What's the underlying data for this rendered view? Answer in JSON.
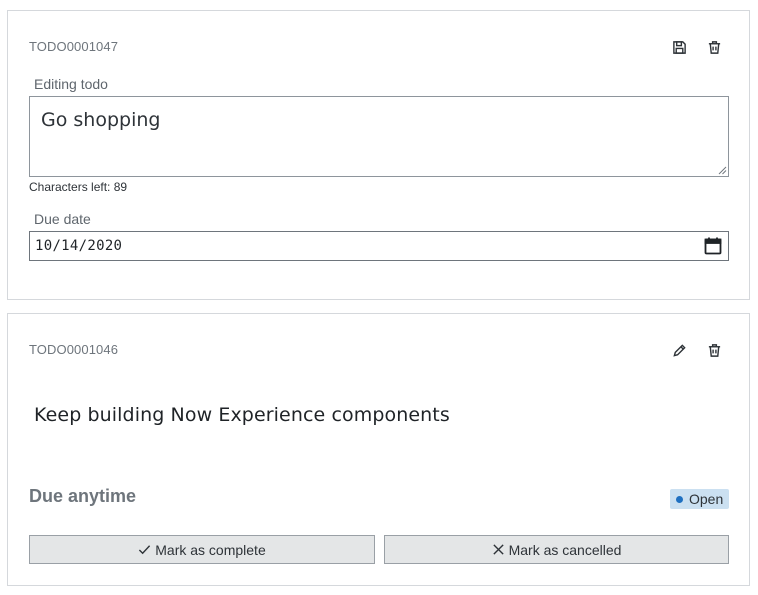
{
  "editing_card": {
    "todo_id": "TODO0001047",
    "save_icon": "save-icon",
    "delete_icon": "trash-icon",
    "text_label": "Editing todo",
    "text_value": "Go shopping",
    "chars_left": "Characters left: 89",
    "date_label": "Due date",
    "date_value": "10/14/2020",
    "calendar_icon": "calendar-icon"
  },
  "view_card": {
    "todo_id": "TODO0001046",
    "edit_icon": "pencil-icon",
    "delete_icon": "trash-icon",
    "text": "Keep building Now Experience components",
    "due": "Due anytime",
    "status": "Open",
    "status_color": "#1f70c1",
    "status_bg": "#cbe0f1",
    "complete_label": "Mark as complete",
    "cancel_label": "Mark as cancelled"
  }
}
